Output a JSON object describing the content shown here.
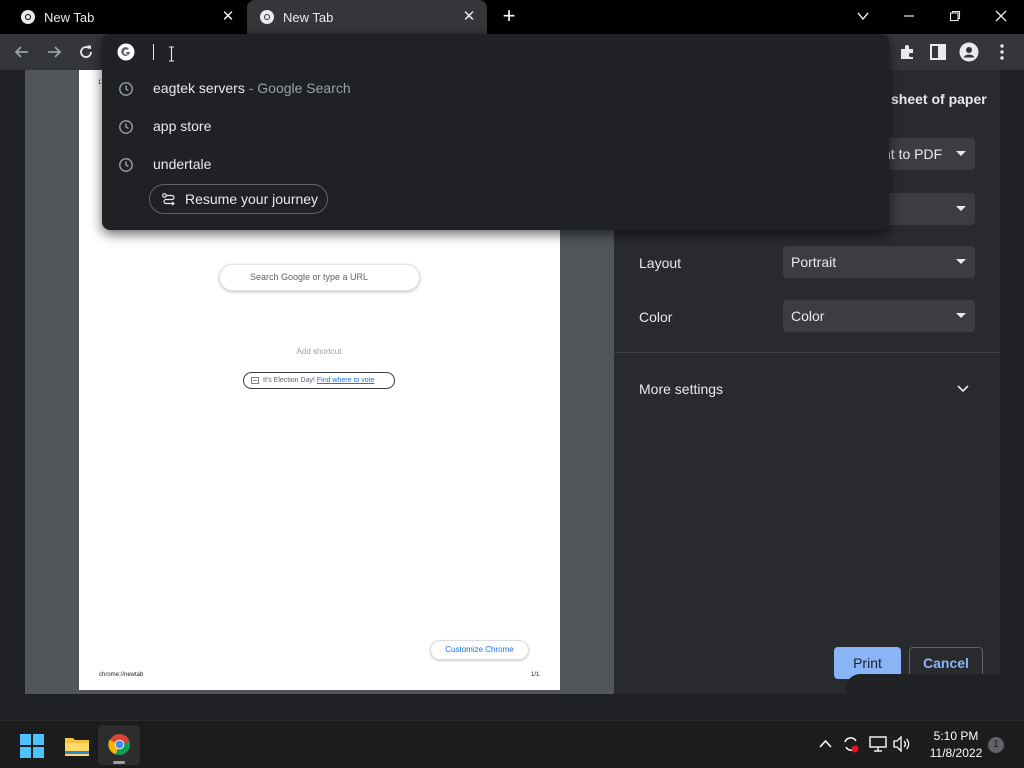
{
  "tabs": [
    {
      "title": "New Tab",
      "active": false
    },
    {
      "title": "New Tab",
      "active": true
    }
  ],
  "omnibox": {
    "input_value": "",
    "suggestions": [
      {
        "text": "eagtek servers",
        "sub": "- Google Search"
      },
      {
        "text": "app store",
        "sub": ""
      },
      {
        "text": "undertale",
        "sub": ""
      }
    ],
    "journey_label": "Resume your journey"
  },
  "print_panel": {
    "header_fragment": "sheet of paper",
    "destination_fragment": "nt to PDF",
    "pages_value": "",
    "layout_label": "Layout",
    "layout_value": "Portrait",
    "color_label": "Color",
    "color_value": "Color",
    "more_settings_label": "More settings",
    "print_label": "Print",
    "cancel_label": "Cancel"
  },
  "preview": {
    "search_placeholder": "Search Google or type a URL",
    "add_shortcut": "Add shortcut",
    "election_text": "It's Election Day!",
    "election_link": "Find where to vote",
    "customize_label": "Customize Chrome",
    "footer_url": "chrome://newtab",
    "footer_page": "1/1",
    "header_fragment": "1"
  },
  "taskbar": {
    "time": "5:10 PM",
    "date": "11/8/2022",
    "notification_count": "1",
    "apps": [
      "start-icon",
      "file-explorer-icon",
      "chrome-icon"
    ]
  },
  "colors": {
    "accent": "#8ab4f8",
    "panel_bg": "#292a2d",
    "omnibox_bg": "#202124"
  }
}
